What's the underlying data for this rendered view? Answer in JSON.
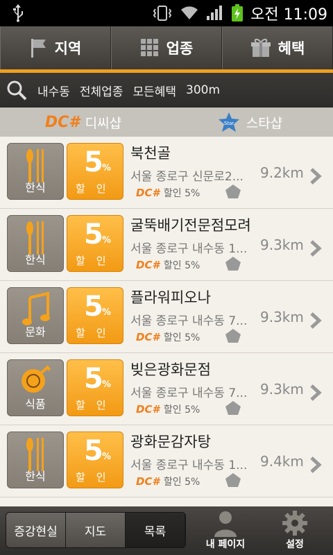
{
  "status_bar": {
    "time": "오전 11:09"
  },
  "top_nav": [
    {
      "label": "지역",
      "icon": "flag-icon"
    },
    {
      "label": "업종",
      "icon": "grid-icon"
    },
    {
      "label": "혜택",
      "icon": "gift-icon"
    }
  ],
  "filter": {
    "region": "내수동",
    "category": "전체업종",
    "benefit": "모든혜택",
    "radius": "300m"
  },
  "tabs": [
    {
      "label": "디씨샵",
      "logo": "DC#"
    },
    {
      "label": "스타샵",
      "logo": "Star"
    }
  ],
  "items": [
    {
      "category": "한식",
      "icon": "utensils-icon",
      "discount": "5",
      "pct": "%",
      "discount_label": "할인",
      "name": "북천골",
      "address": "서울 종로구 신문로2...",
      "distance": "9.2km",
      "dc_logo": "DC#",
      "benefit": "할인 5%"
    },
    {
      "category": "한식",
      "icon": "utensils-icon",
      "discount": "5",
      "pct": "%",
      "discount_label": "할인",
      "name": "굴뚝배기전문점모려",
      "address": "서울 종로구 내수동 1...",
      "distance": "9.3km",
      "dc_logo": "DC#",
      "benefit": "할인 5%"
    },
    {
      "category": "문화",
      "icon": "music-note-icon",
      "discount": "5",
      "pct": "%",
      "discount_label": "할인",
      "name": "플라워피오나",
      "address": "서울 종로구 내수동 7...",
      "distance": "9.3km",
      "dc_logo": "DC#",
      "benefit": "할인 5%"
    },
    {
      "category": "식품",
      "icon": "chicken-icon",
      "discount": "5",
      "pct": "%",
      "discount_label": "할인",
      "name": "빚은광화문점",
      "address": "서울 종로구 내수동 7...",
      "distance": "9.3km",
      "dc_logo": "DC#",
      "benefit": "할인 5%"
    },
    {
      "category": "한식",
      "icon": "utensils-icon",
      "discount": "5",
      "pct": "%",
      "discount_label": "할인",
      "name": "광화문감자탕",
      "address": "서울 종로구 내수동 1...",
      "distance": "9.4km",
      "dc_logo": "DC#",
      "benefit": "할인 5%"
    }
  ],
  "bottom": {
    "segments": [
      "증강현실",
      "지도",
      "목록"
    ],
    "active_segment": "목록",
    "my_page": "내 페이지",
    "settings": "설정"
  }
}
